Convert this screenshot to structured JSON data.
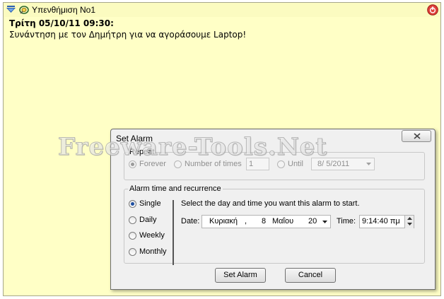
{
  "note": {
    "title": "Υπενθήμιση Νο1",
    "heading": "Τρίτη 05/10/11 09:30:",
    "body": "Συνάντηση με τον Δημήτρη για να αγοράσουμε Laptop!"
  },
  "watermark": "Freeware-Tools.Net",
  "dialog": {
    "title": "Set Alarm",
    "repeat": {
      "legend": "Repeat",
      "forever_label": "Forever",
      "number_of_times_label": "Number of times",
      "number_of_times_value": "1",
      "until_label": "Until",
      "until_date": "8/ 5/2011"
    },
    "alarm_time": {
      "legend": "Alarm time and recurrence",
      "options": [
        "Single",
        "Daily",
        "Weekly",
        "Monthly"
      ],
      "selected": "Single",
      "instruction": "Select the day and time you want this alarm to start.",
      "date_label": "Date:",
      "date_weekday": "Κυριακή",
      "date_sep": ",",
      "date_day": "8",
      "date_month": "Μαΐου",
      "date_year": "20",
      "time_label": "Time:",
      "time_value": "9:14:40 πμ"
    },
    "set_alarm_label": "Set Alarm",
    "cancel_label": "Cancel"
  },
  "colors": {
    "note_background": "#ffffc6",
    "dialog_background": "#f0f0f0",
    "radio_selected": "#1f4fa0",
    "close_icon_red": "#e0403a"
  }
}
